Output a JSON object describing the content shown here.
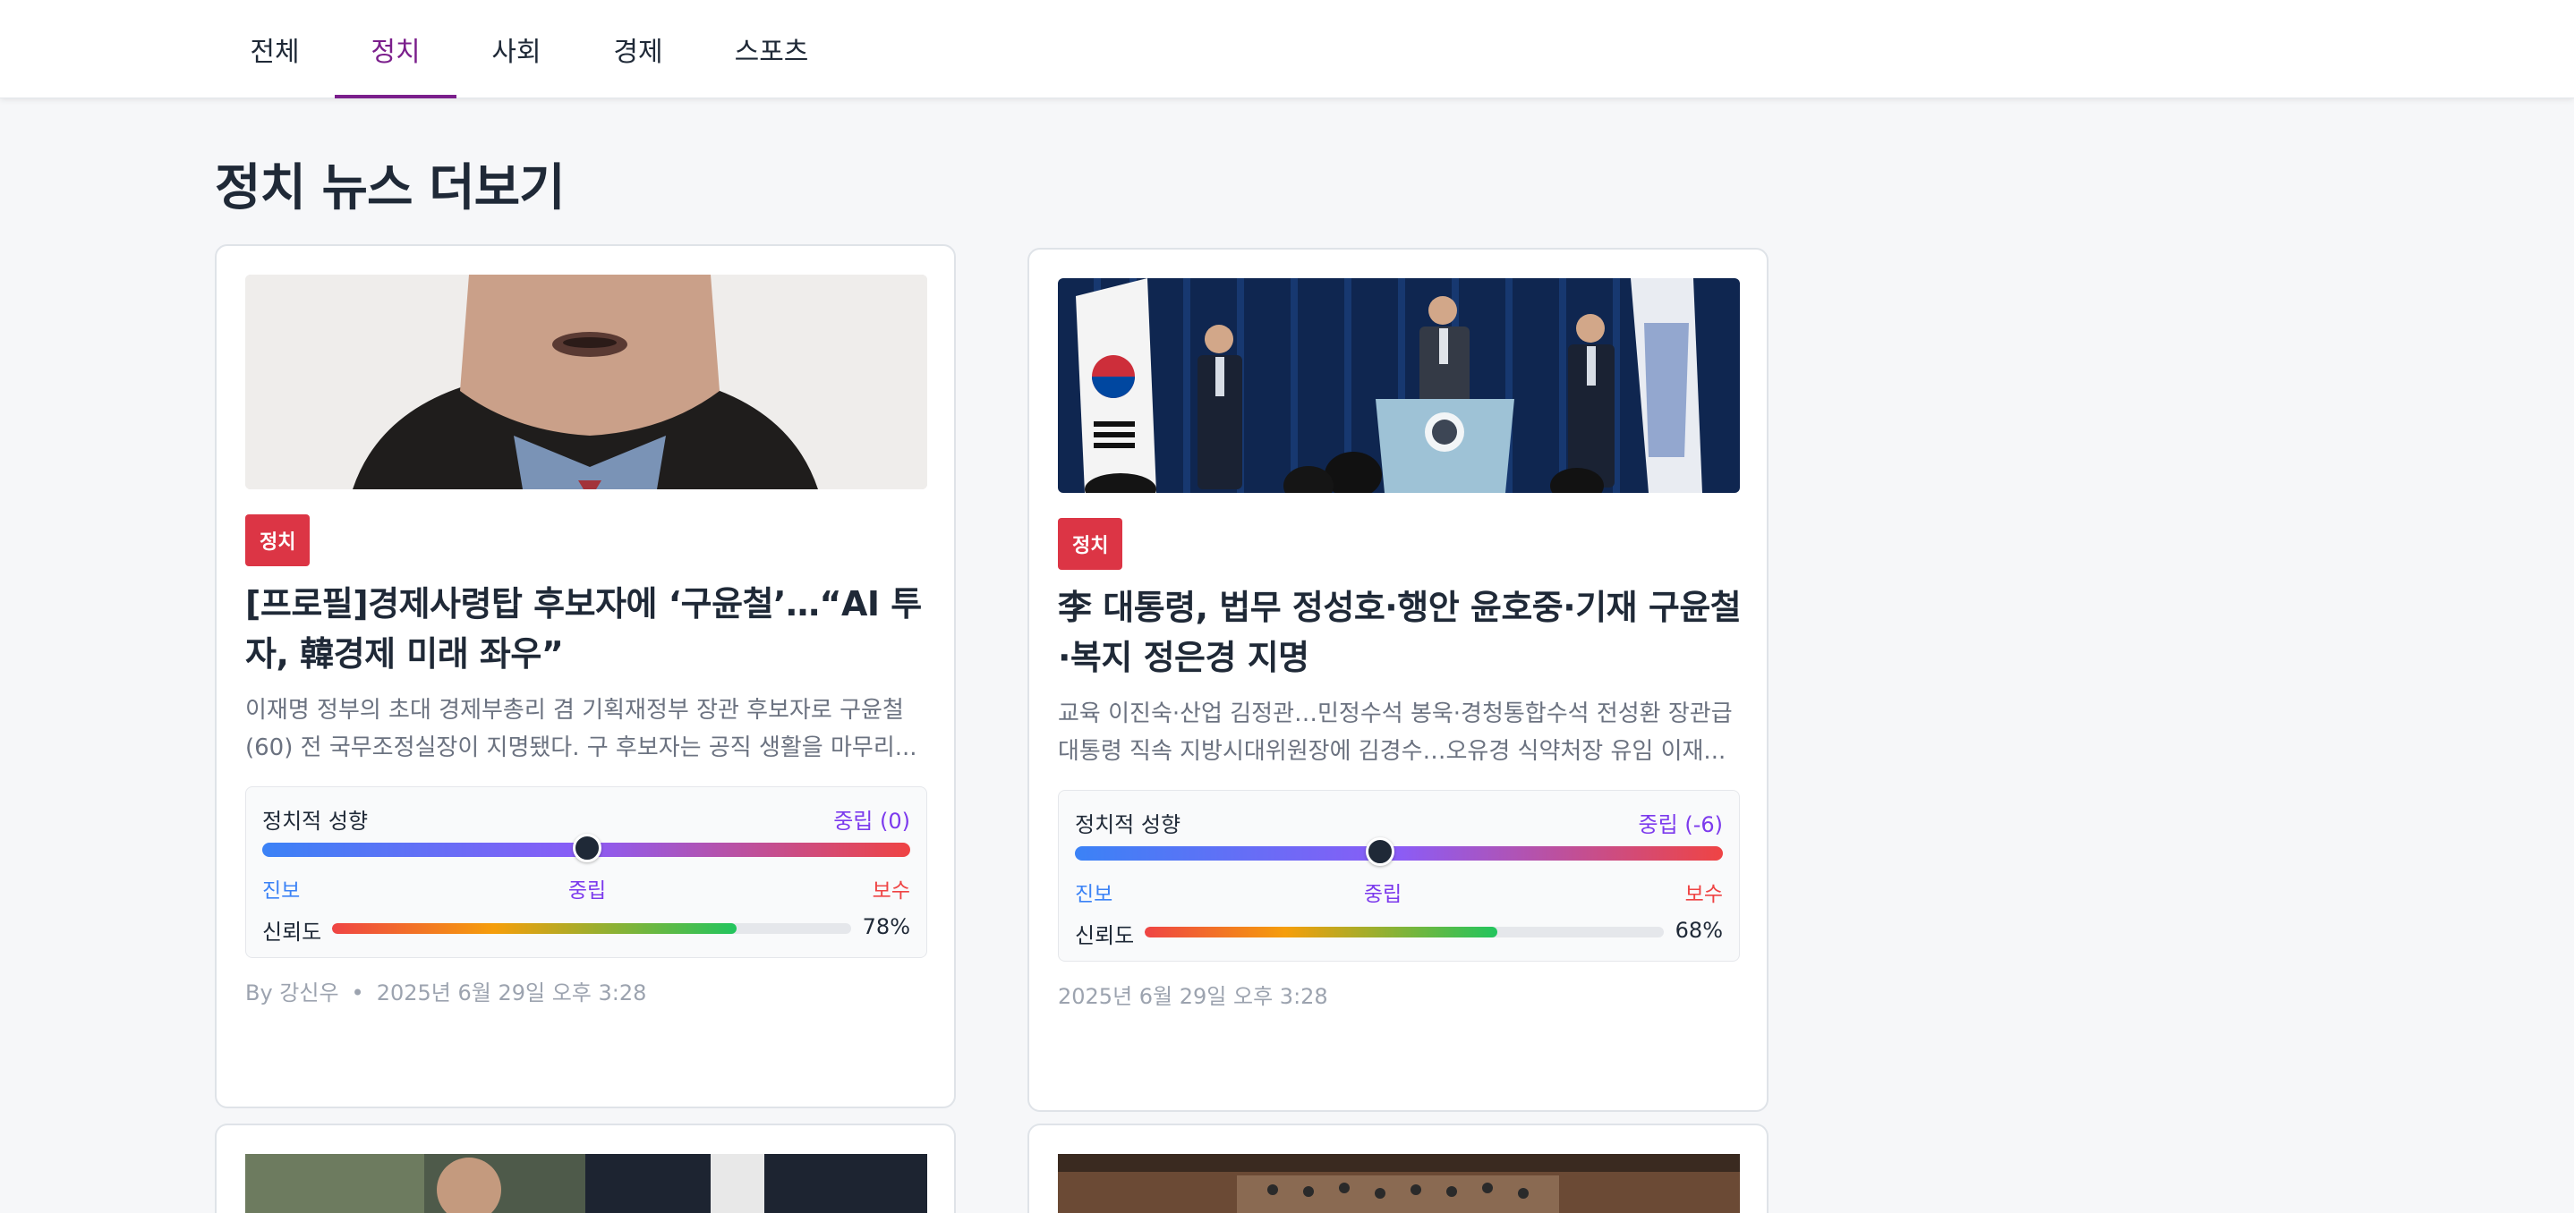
{
  "nav": {
    "tabs": [
      {
        "label": "전체"
      },
      {
        "label": "정치"
      },
      {
        "label": "사회"
      },
      {
        "label": "경제"
      },
      {
        "label": "스포츠"
      }
    ],
    "active_index": 1
  },
  "section_title": "정치 뉴스 더보기",
  "colors": {
    "accent": "#7b1f8c",
    "badge": "#dc3545",
    "progressive": "#3b82f6",
    "neutral": "#7c3aed",
    "conservative": "#ef4444"
  },
  "labels": {
    "lean_title": "정치적 성향",
    "scale_left": "진보",
    "scale_mid": "중립",
    "scale_right": "보수",
    "reliability": "신뢰도"
  },
  "cards": [
    {
      "category": "정치",
      "headline": "[프로필]경제사령탑 후보자에 ‘구윤철’…“AI 투자, 韓경제 미래 좌우”",
      "summary": "이재명 정부의 초대 경제부총리 겸 기획재정부 장관 후보자로 구윤철(60) 전 국무조정실장이 지명됐다. 구 후보자는 공직 생활을 마무리...",
      "lean_text": "중립 (0)",
      "lean_score": 0,
      "reliability_percent": 78,
      "reliability_text": "78%",
      "author": "By 강신우",
      "dot": "•",
      "date": "2025년 6월 29일 오후 3:28"
    },
    {
      "category": "정치",
      "headline": "李 대통령, 법무 정성호·행안 윤호중·기재 구윤철·복지 정은경 지명",
      "summary": "교육 이진숙·산업 김정관…민정수석 봉욱·경청통합수석 전성환 장관급 대통령 직속 지방시대위원장에 김경수…오유경 식약처장 유임 이재...",
      "lean_text": "중립 (-6)",
      "lean_score": -6,
      "reliability_percent": 68,
      "reliability_text": "68%",
      "author": "",
      "dot": "",
      "date": "2025년 6월 29일 오후 3:28"
    }
  ]
}
